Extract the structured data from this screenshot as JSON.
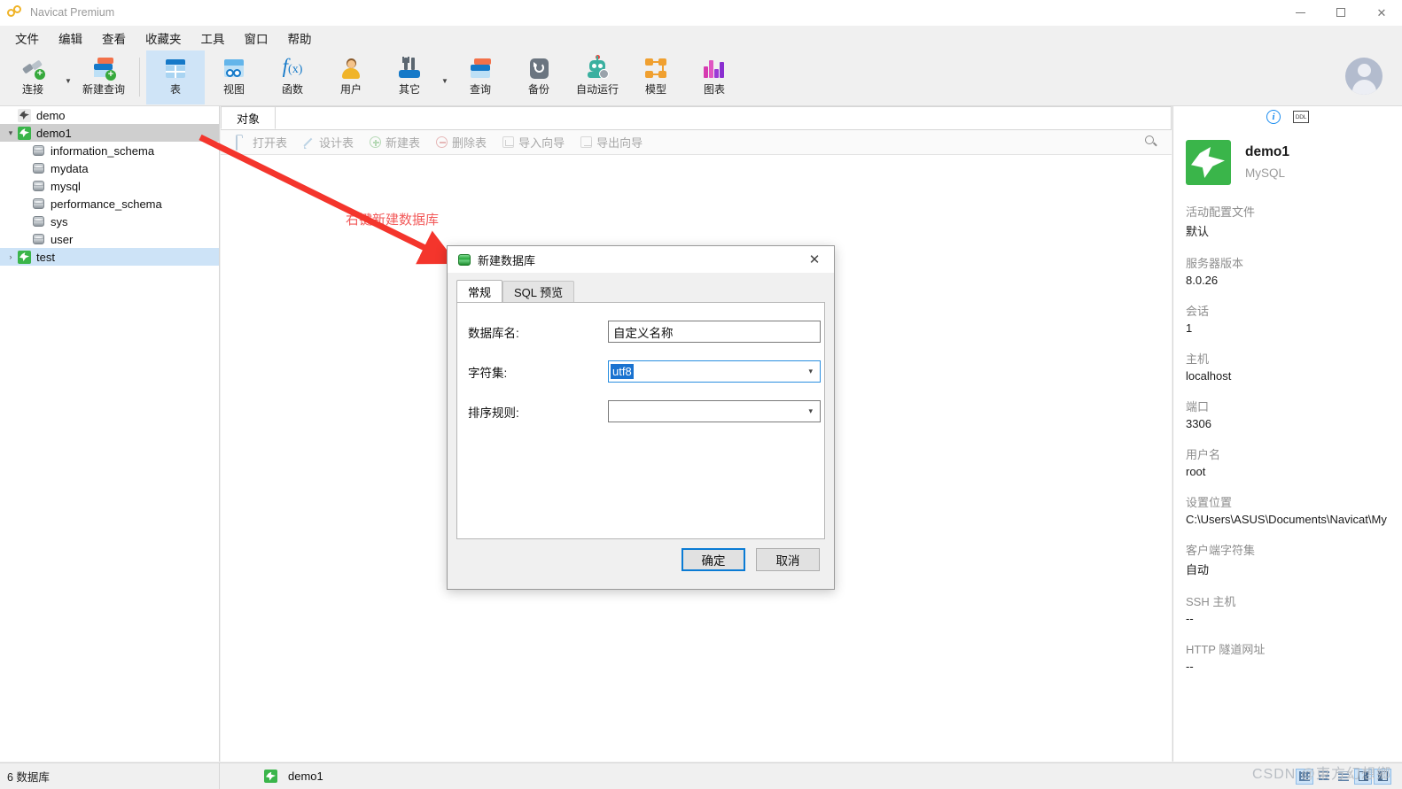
{
  "window": {
    "title": "Navicat Premium",
    "app_icon": "navicat-logo-icon",
    "minimize": "—",
    "maximize": "□",
    "close": "✕"
  },
  "menubar": {
    "items": [
      {
        "label": "文件"
      },
      {
        "label": "编辑"
      },
      {
        "label": "查看"
      },
      {
        "label": "收藏夹"
      },
      {
        "label": "工具"
      },
      {
        "label": "窗口"
      },
      {
        "label": "帮助"
      }
    ]
  },
  "toolbar": {
    "items": [
      {
        "label": "连接",
        "icon": "connection-plus-icon",
        "active": false,
        "caret": true
      },
      {
        "label": "新建查询",
        "icon": "new-query-icon",
        "active": false,
        "caret": false
      },
      {
        "label": "表",
        "icon": "table-icon",
        "active": true,
        "caret": false
      },
      {
        "label": "视图",
        "icon": "view-icon",
        "active": false,
        "caret": false
      },
      {
        "label": "函数",
        "icon": "function-fx-icon",
        "active": false,
        "caret": false
      },
      {
        "label": "用户",
        "icon": "user-icon",
        "active": false,
        "caret": false
      },
      {
        "label": "其它",
        "icon": "other-tools-icon",
        "active": false,
        "caret": true
      },
      {
        "label": "查询",
        "icon": "query-icon",
        "active": false,
        "caret": false
      },
      {
        "label": "备份",
        "icon": "backup-icon",
        "active": false,
        "caret": false
      },
      {
        "label": "自动运行",
        "icon": "automation-robot-icon",
        "active": false,
        "caret": false
      },
      {
        "label": "模型",
        "icon": "model-icon",
        "active": false,
        "caret": false
      },
      {
        "label": "图表",
        "icon": "chart-icon",
        "active": false,
        "caret": false
      }
    ],
    "avatar": "user-avatar"
  },
  "sidebar": {
    "tree": [
      {
        "label": "demo",
        "type": "connection",
        "indent": 1,
        "twisty": "",
        "state": "normal",
        "icon_color": "#e9e9e9"
      },
      {
        "label": "demo1",
        "type": "connection",
        "indent": 0,
        "twisty": "⌄",
        "state": "selected-gray",
        "icon_color": "#3ab54a"
      },
      {
        "label": "information_schema",
        "type": "database",
        "indent": 2,
        "twisty": "",
        "state": "normal"
      },
      {
        "label": "mydata",
        "type": "database",
        "indent": 2,
        "twisty": "",
        "state": "normal"
      },
      {
        "label": "mysql",
        "type": "database",
        "indent": 2,
        "twisty": "",
        "state": "normal"
      },
      {
        "label": "performance_schema",
        "type": "database",
        "indent": 2,
        "twisty": "",
        "state": "normal"
      },
      {
        "label": "sys",
        "type": "database",
        "indent": 2,
        "twisty": "",
        "state": "normal"
      },
      {
        "label": "user",
        "type": "database",
        "indent": 2,
        "twisty": "",
        "state": "normal"
      },
      {
        "label": "test",
        "type": "connection",
        "indent": 0,
        "twisty": "›",
        "state": "selected-blue",
        "icon_color": "#3ab54a"
      }
    ]
  },
  "main": {
    "tab": "对象",
    "objbar": [
      {
        "label": "打开表",
        "icon": "open-table-icon"
      },
      {
        "label": "设计表",
        "icon": "design-table-icon"
      },
      {
        "label": "新建表",
        "icon": "new-table-icon"
      },
      {
        "label": "删除表",
        "icon": "delete-table-icon"
      },
      {
        "label": "导入向导",
        "icon": "import-wizard-icon"
      },
      {
        "label": "导出向导",
        "icon": "export-wizard-icon"
      }
    ],
    "search_icon": "search-icon",
    "annotation": "右键新建数据库"
  },
  "info_panel": {
    "info_icon": "info-circle-icon",
    "ddl_icon": "ddl-icon",
    "name": "demo1",
    "type": "MySQL",
    "fields": [
      {
        "label": "活动配置文件",
        "value": "默认"
      },
      {
        "label": "服务器版本",
        "value": "8.0.26"
      },
      {
        "label": "会话",
        "value": "1"
      },
      {
        "label": "主机",
        "value": "localhost"
      },
      {
        "label": "端口",
        "value": "3306"
      },
      {
        "label": "用户名",
        "value": "root"
      },
      {
        "label": "设置位置",
        "value": "C:\\Users\\ASUS\\Documents\\Navicat\\My"
      },
      {
        "label": "客户端字符集",
        "value": "自动"
      },
      {
        "label": "SSH 主机",
        "value": "--"
      },
      {
        "label": "HTTP 隧道网址",
        "value": "--"
      }
    ]
  },
  "dialog": {
    "title": "新建数据库",
    "icon": "database-green-icon",
    "close": "✕",
    "tabs": [
      {
        "label": "常规",
        "active": true
      },
      {
        "label": "SQL 预览",
        "active": false
      }
    ],
    "fields": {
      "dbname_label": "数据库名:",
      "dbname_value": "自定义名称",
      "charset_label": "字符集:",
      "charset_value": "utf8",
      "collation_label": "排序规则:",
      "collation_value": ""
    },
    "buttons": {
      "ok": "确定",
      "cancel": "取消"
    }
  },
  "statusbar": {
    "left": "6 数据库",
    "connection": "demo1",
    "views": [
      "grid-view-icon",
      "list-view-icon",
      "detail-view-icon",
      "split-right-icon",
      "split-left-icon"
    ]
  },
  "watermark": "CSDN @東方幻想鄉",
  "colors": {
    "accent_blue": "#1579c8",
    "selection_blue": "#1a73d0",
    "annotation_red": "#f25a5a",
    "mysql_green": "#3ab54a"
  }
}
